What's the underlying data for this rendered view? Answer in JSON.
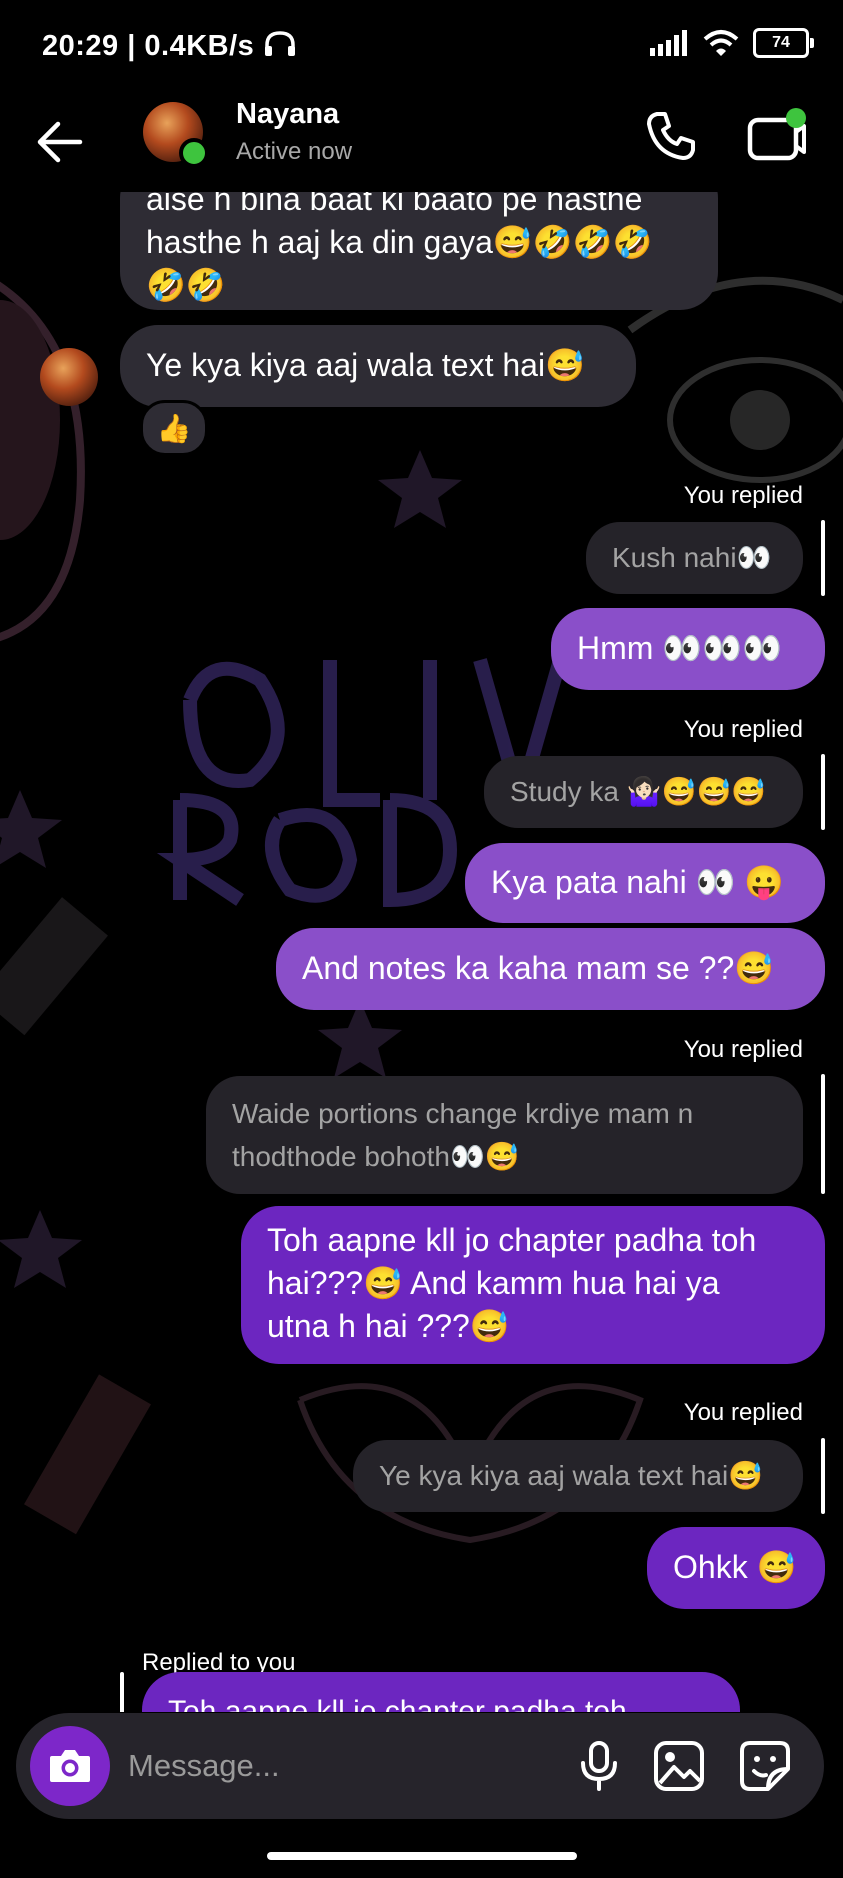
{
  "status_bar": {
    "time_speed": "20:29 | 0.4KB/s",
    "battery": "74"
  },
  "header": {
    "name": "Nayana",
    "status": "Active now"
  },
  "messages": {
    "m1": {
      "line1": "aise h bina baat ki baato pe hasthe",
      "line2": "hasthe h aaj ka din gaya😅🤣🤣🤣",
      "line3": "🤣🤣"
    },
    "m2": "Ye kya kiya aaj wala text hai😅",
    "reaction": "👍",
    "reply1_label": "You replied",
    "quote1": "Kush nahi👀",
    "m3": "Hmm 👀👀👀",
    "reply2_label": "You replied",
    "quote2": "Study ka 🤷🏻‍♀️😅😅😅",
    "m4": "Kya pata nahi 👀 😛",
    "m5": "And notes ka kaha mam se ??😅",
    "reply3_label": "You replied",
    "quote3": {
      "line1": "Waide portions change krdiye mam n",
      "line2": "thodthode bohoth👀😅"
    },
    "m6": {
      "line1": "Toh aapne kll jo chapter padha toh",
      "line2": "hai???😅 And kamm hua hai ya",
      "line3": "utna h hai ???😅"
    },
    "reply4_label": "You replied",
    "quote4": "Ye kya kiya aaj wala text hai😅",
    "m7": "Ohkk 😅",
    "reply5_label": "Replied to you",
    "quote5": "Toh aapne kll jo chapter padha toh hai???"
  },
  "composer": {
    "placeholder": "Message..."
  },
  "icons": {
    "back": "arrow-left-icon",
    "call": "phone-icon",
    "video": "video-camera-icon",
    "camera": "camera-icon",
    "mic": "microphone-icon",
    "gallery": "image-icon",
    "sticker": "sticker-icon"
  }
}
